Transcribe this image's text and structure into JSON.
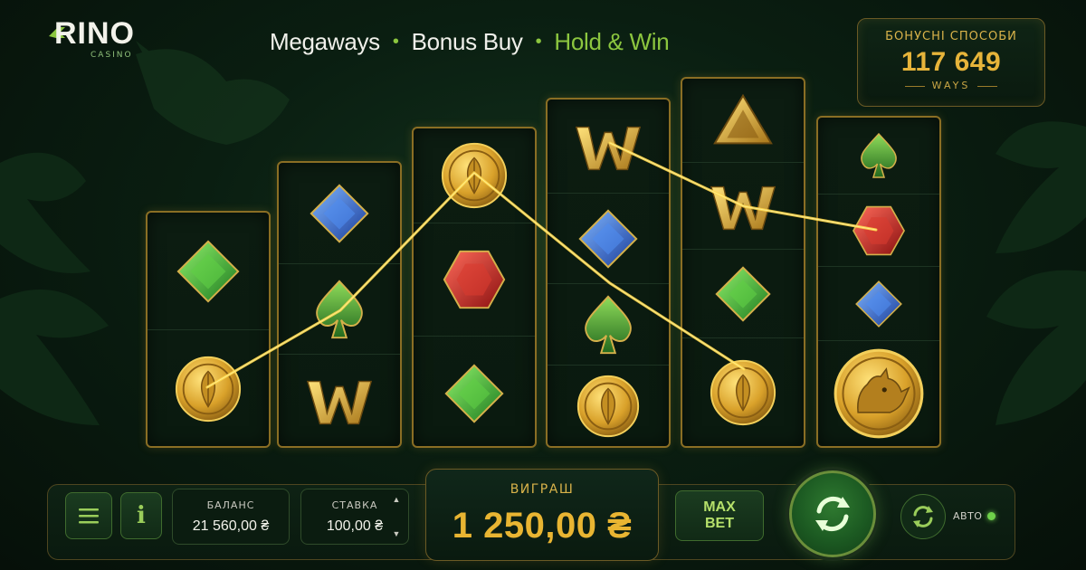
{
  "brand": {
    "name": "RINO",
    "sub": "CASINO"
  },
  "features": [
    "Megaways",
    "Bonus Buy",
    "Hold & Win"
  ],
  "ways": {
    "title": "БОНУСНІ СПОСОБИ",
    "value": "117 649",
    "label": "WAYS"
  },
  "reels": [
    [
      "emerald",
      "gold-coin"
    ],
    [
      "sapphire",
      "spade",
      "wild"
    ],
    [
      "gold-coin",
      "ruby",
      "emerald"
    ],
    [
      "wild",
      "sapphire",
      "spade",
      "gold-coin"
    ],
    [
      "gold-pyramid",
      "wild",
      "emerald",
      "gold-coin"
    ],
    [
      "spade",
      "ruby",
      "sapphire",
      "rhino-coin"
    ]
  ],
  "balance": {
    "label": "БАЛАНС",
    "value": "21 560,00 ₴"
  },
  "bet": {
    "label": "СТАВКА",
    "value": "100,00 ₴"
  },
  "win": {
    "label": "ВИГРАШ",
    "value": "1 250,00 ₴"
  },
  "buttons": {
    "menu": "menu-icon",
    "info": "i",
    "max_bet_line1": "MAX",
    "max_bet_line2": "BET",
    "spin": "spin-icon",
    "auto": "АВТО"
  },
  "colors": {
    "gold": "#e9b532",
    "green_accent": "#8cc63f",
    "bg": "#0a1a0f"
  }
}
